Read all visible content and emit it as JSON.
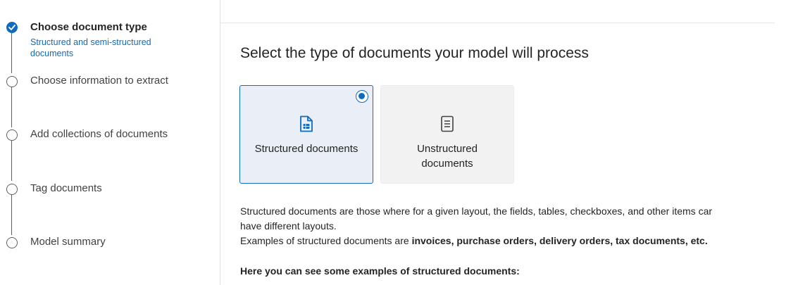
{
  "steps": [
    {
      "title": "Choose document type",
      "subtitle": "Structured and semi-structured documents",
      "state": "completed"
    },
    {
      "title": "Choose information to extract",
      "state": "pending"
    },
    {
      "title": "Add collections of documents",
      "state": "pending"
    },
    {
      "title": "Tag documents",
      "state": "pending"
    },
    {
      "title": "Model summary",
      "state": "pending"
    }
  ],
  "main": {
    "heading": "Select the type of documents your model will process",
    "options": [
      {
        "label": "Structured documents",
        "icon": "structured-document-icon",
        "selected": true
      },
      {
        "label": "Unstructured documents",
        "icon": "text-document-icon",
        "selected": false
      }
    ],
    "description": {
      "line1": "Structured documents are those where for a given layout, the fields, tables, checkboxes, and other items car",
      "line2": "have different layouts.",
      "line3_prefix": "Examples of structured documents are ",
      "line3_bold": "invoices, purchase orders, delivery orders, tax documents, etc."
    },
    "examples_heading": "Here you can see some examples of structured documents:"
  },
  "colors": {
    "accent": "#0f6cbd",
    "selected_card_bg": "#e9eef7",
    "card_bg": "#f2f2f2"
  }
}
